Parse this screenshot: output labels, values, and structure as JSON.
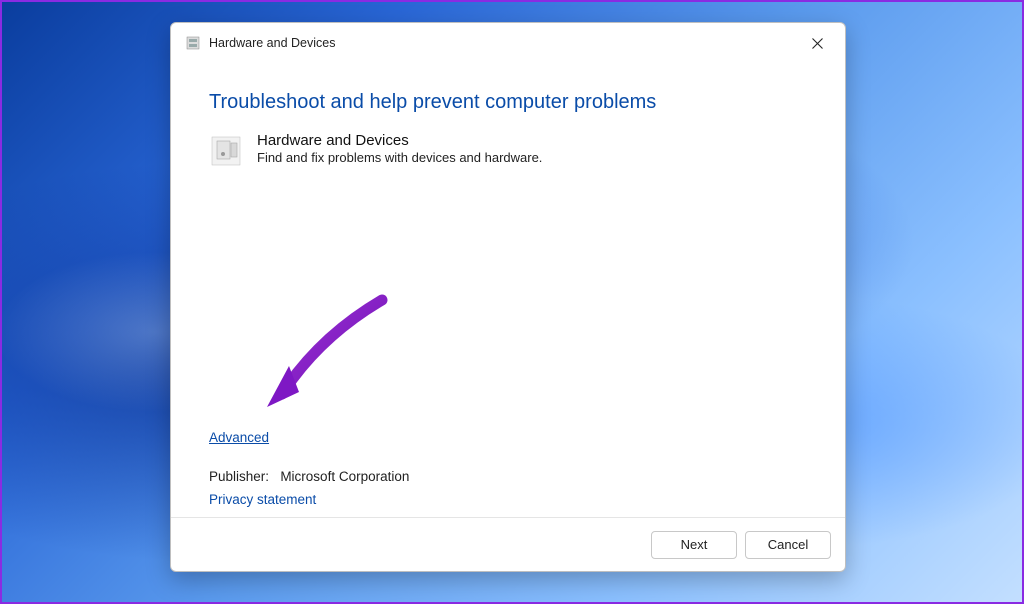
{
  "dialog": {
    "title": "Hardware and Devices",
    "heading": "Troubleshoot and help prevent computer problems",
    "item": {
      "title": "Hardware and Devices",
      "description": "Find and fix problems with devices and hardware."
    },
    "advanced_link": "Advanced",
    "publisher_label": "Publisher:",
    "publisher_value": "Microsoft Corporation",
    "privacy_link": "Privacy statement",
    "buttons": {
      "next": "Next",
      "cancel": "Cancel"
    }
  }
}
